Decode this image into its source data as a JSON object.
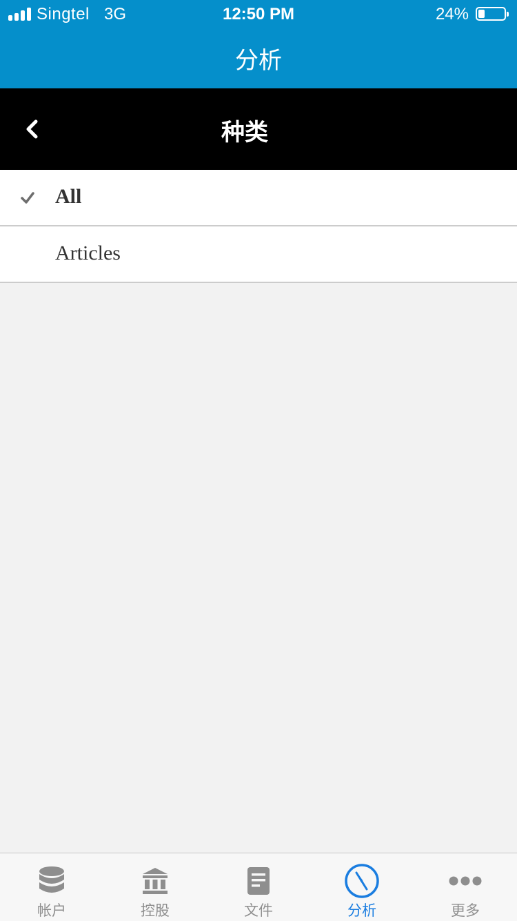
{
  "status_bar": {
    "carrier": "Singtel",
    "network": "3G",
    "time": "12:50 PM",
    "battery_percent": "24%",
    "battery_level": 0.24
  },
  "header": {
    "title": "分析"
  },
  "subheader": {
    "title": "种类",
    "back_icon": "chevron-left-icon"
  },
  "category_list": {
    "items": [
      {
        "label": "All",
        "selected": true
      },
      {
        "label": "Articles",
        "selected": false
      }
    ]
  },
  "tab_bar": {
    "tabs": [
      {
        "label": "帐户",
        "icon": "database-icon",
        "active": false
      },
      {
        "label": "控股",
        "icon": "bank-icon",
        "active": false
      },
      {
        "label": "文件",
        "icon": "document-icon",
        "active": false
      },
      {
        "label": "分析",
        "icon": "compass-icon",
        "active": true
      },
      {
        "label": "更多",
        "icon": "more-dots-icon",
        "active": false
      }
    ]
  },
  "colors": {
    "header_blue": "#058fcb",
    "subheader_black": "#000000",
    "tab_active": "#1a7de0",
    "tab_inactive": "#8e8e8e",
    "background": "#f2f2f2"
  }
}
